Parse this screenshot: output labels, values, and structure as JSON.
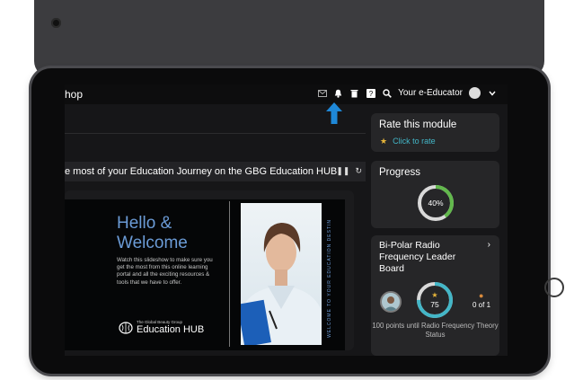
{
  "topbar": {
    "title": "hop",
    "user_label": "Your e-Educator",
    "icons": [
      "mail-icon",
      "bell-icon",
      "trash-icon",
      "help-icon",
      "search-icon",
      "avatar",
      "chevron-down-icon"
    ]
  },
  "slideshow": {
    "heading": "e most of your Education Journey on the GBG Education HUB",
    "hello": "Hello &",
    "welcome": "Welcome",
    "description": "Watch this slideshow to make sure you get the most from this online learning portal and all the exciting resources & tools that we have to offer.",
    "logo_small": "The Global Beauty Group",
    "logo_big": "Education HUB",
    "vertical_text": "WELCOME TO YOUR EDUCATION DESTIN"
  },
  "rate": {
    "title": "Rate this module",
    "link": "Click to rate"
  },
  "progress": {
    "title": "Progress",
    "value_label": "40%",
    "value": 0.4
  },
  "leaderboard": {
    "title": "Bi-Polar Radio Frequency Leader Board",
    "points": "75",
    "rank": "0 of 1",
    "footer": "100 points until Radio Frequency Theory Status",
    "points_fraction": 0.75
  },
  "colors": {
    "accent": "#43b6c7",
    "star": "#e8b63a",
    "progress": "#62b84c",
    "hello": "#6b9bd6",
    "arrow": "#1e88d8"
  }
}
